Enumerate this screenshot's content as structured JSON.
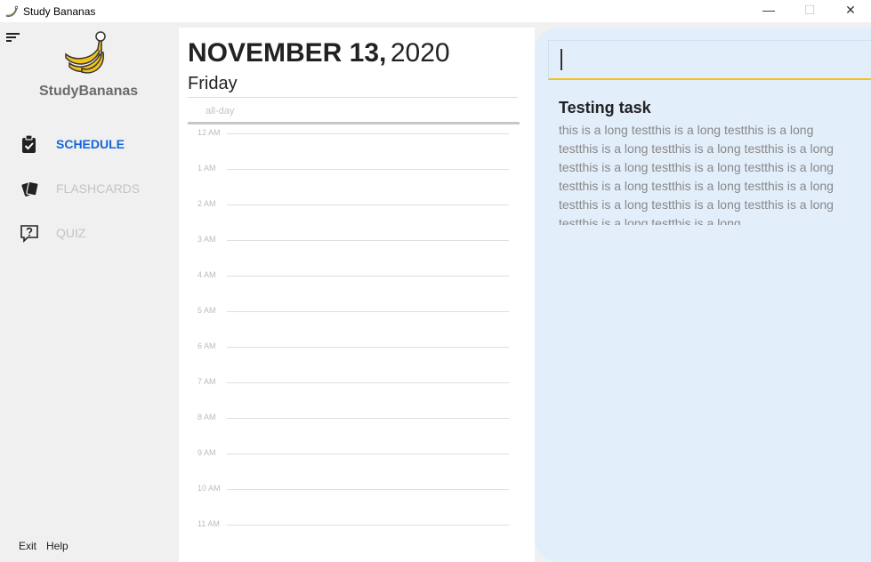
{
  "window": {
    "title": "Study Bananas",
    "controls": {
      "minimize": "—",
      "maximize": "☐",
      "close": "✕"
    }
  },
  "sidebar": {
    "brand": "StudyBananas",
    "nav": [
      {
        "label": "SCHEDULE",
        "icon": "clipboard-check-icon",
        "active": true
      },
      {
        "label": "FLASHCARDS",
        "icon": "cards-icon",
        "active": false
      },
      {
        "label": "QUIZ",
        "icon": "question-bubble-icon",
        "active": false
      }
    ],
    "footer": {
      "exit": "Exit",
      "help": "Help"
    }
  },
  "schedule": {
    "month_day": "NOVEMBER 13,",
    "year": "2020",
    "weekday": "Friday",
    "allday_label": "all-day",
    "hours": [
      "12 AM",
      "1 AM",
      "2 AM",
      "3 AM",
      "4 AM",
      "5 AM",
      "6 AM",
      "7 AM",
      "8 AM",
      "9 AM",
      "10 AM",
      "11 AM"
    ]
  },
  "task": {
    "input_value": "",
    "title": "Testing task",
    "description": "this is a long testthis is a long testthis is a long testthis is a long testthis is a long testthis is a long testthis is a long testthis is a long testthis is a long testthis is a long testthis is a long testthis is a long testthis is a long testthis is a long testthis is a long testthis is a long testthis is a long"
  },
  "colors": {
    "accent_blue": "#1565d8",
    "panel_bg": "#e3eefb",
    "input_underline": "#f2c21a",
    "banana": "#f2c21a"
  }
}
